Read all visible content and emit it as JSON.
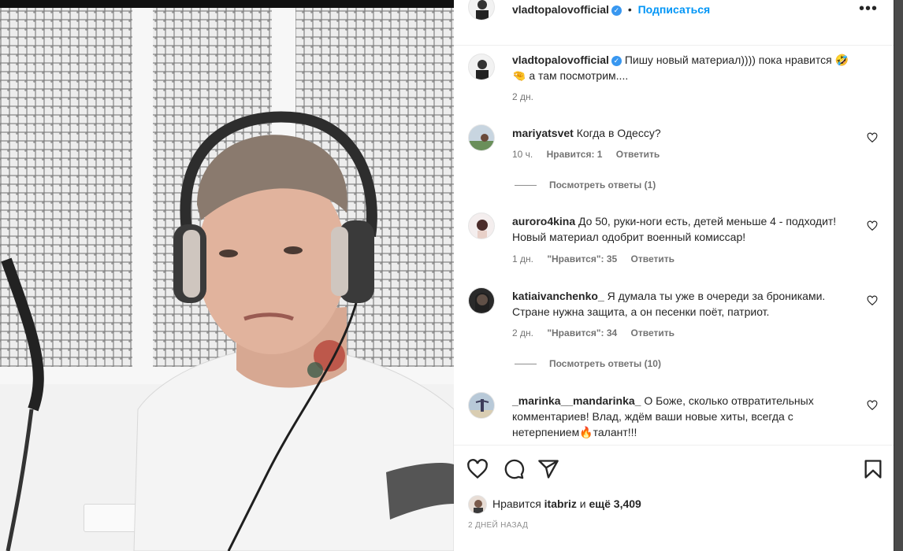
{
  "post": {
    "author": "vladtopalovofficial",
    "follow_label": "Подписаться",
    "dot": "•",
    "more_label": "•••",
    "caption": {
      "username": "vladtopalovofficial",
      "text": "Пишу новый материал)))) пока нравится 🤣🤏 а там посмотрим....",
      "time": "2 дн."
    }
  },
  "comments": [
    {
      "username": "mariyatsvet",
      "text": "Когда в Одессу?",
      "time": "10 ч.",
      "likes": "Нравится: 1",
      "reply": "Ответить",
      "view_replies": "Посмотреть ответы (1)"
    },
    {
      "username": "auroro4kina",
      "text": "До 50, руки-ноги есть, детей меньше 4 - подходит! Новый материал одобрит военный комиссар!",
      "time": "1 дн.",
      "likes": "\"Нравится\": 35",
      "reply": "Ответить"
    },
    {
      "username": "katiaivanchenko_",
      "text": "Я думала ты уже в очереди за брониками. Стране нужна защита, а он песенки поёт, патриот.",
      "time": "2 дн.",
      "likes": "\"Нравится\": 34",
      "reply": "Ответить",
      "view_replies": "Посмотреть ответы (10)"
    },
    {
      "username": "_marinka__mandarinka_",
      "text": "О Боже, сколько отвратительных комментариев! Влад, ждём ваши новые хиты, всегда с нетерпением🔥талант!!!"
    }
  ],
  "likes": {
    "prefix": "Нравится",
    "user": "itabriz",
    "middle": "и",
    "rest": "ещё 3,409"
  },
  "date": "2 ДНЕЙ НАЗАД",
  "icons": {
    "verified": "✓",
    "like": "heart-icon",
    "comment": "comment-icon",
    "share": "share-icon",
    "save": "bookmark-icon"
  }
}
